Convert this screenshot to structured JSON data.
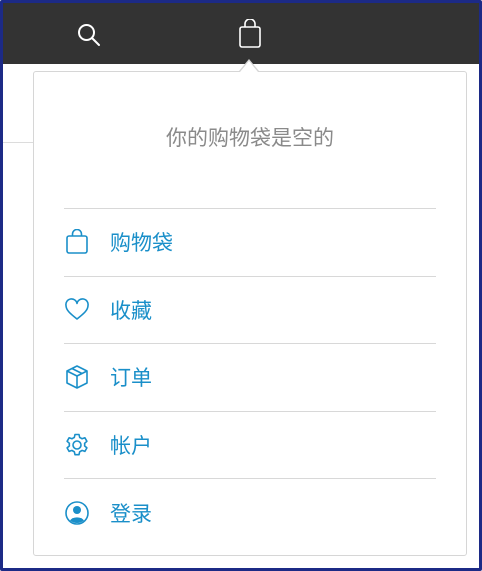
{
  "topbar": {
    "search_icon": "search-icon",
    "bag_icon": "shopping-bag-icon"
  },
  "panel": {
    "empty_message": "你的购物袋是空的",
    "menu": [
      {
        "icon": "bag-icon",
        "label": "购物袋"
      },
      {
        "icon": "heart-icon",
        "label": "收藏"
      },
      {
        "icon": "box-icon",
        "label": "订单"
      },
      {
        "icon": "gear-icon",
        "label": "帐户"
      },
      {
        "icon": "person-icon",
        "label": "登录"
      }
    ]
  },
  "colors": {
    "topbar_bg": "#333333",
    "accent": "#1a8fc9",
    "muted_text": "#8a8a8a",
    "frame": "#1c2a86"
  }
}
